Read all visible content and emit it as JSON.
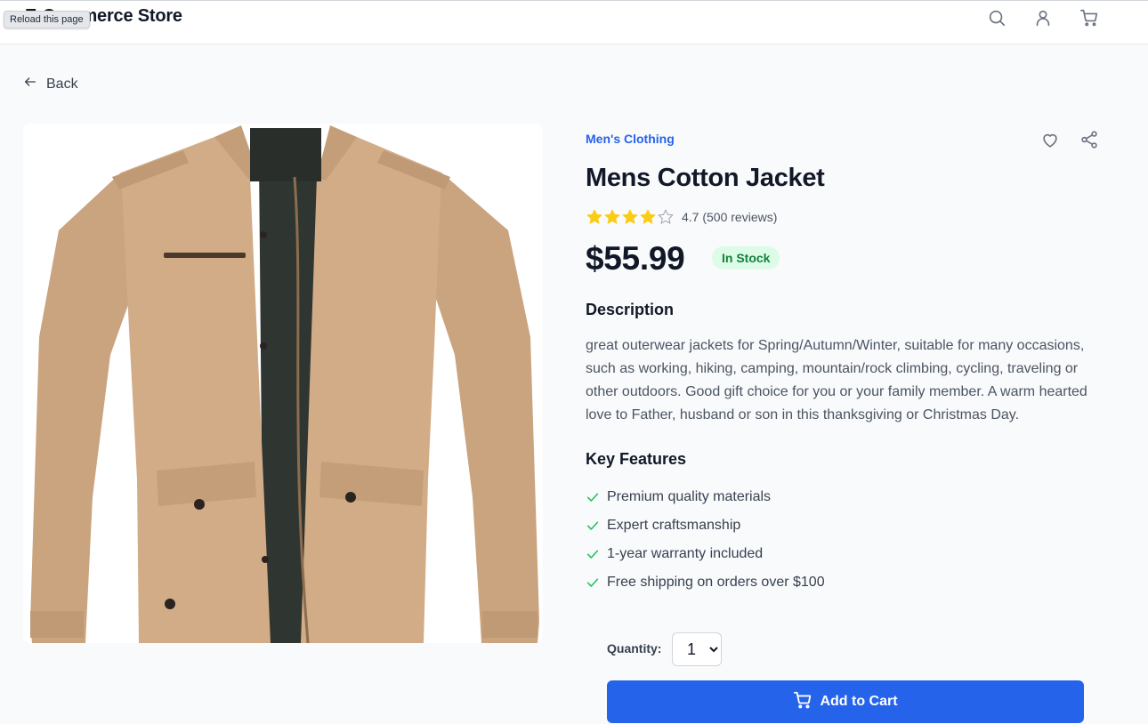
{
  "header": {
    "brand": "E-Commerce Store",
    "tooltip": "Reload this page",
    "icons": [
      "search-icon",
      "user-icon",
      "cart-icon"
    ]
  },
  "nav": {
    "back_label": "Back"
  },
  "product": {
    "category": "Men's Clothing",
    "title": "Mens Cotton Jacket",
    "rating": 4.7,
    "rating_text": "4.7 (500 reviews)",
    "stars_filled": 4,
    "stars_total": 5,
    "price": "$55.99",
    "stock_badge": "In Stock",
    "description_heading": "Description",
    "description": "great outerwear jackets for Spring/Autumn/Winter, suitable for many occasions, such as working, hiking, camping, mountain/rock climbing, cycling, traveling or other outdoors. Good gift choice for you or your family member. A warm hearted love to Father, husband or son in this thanksgiving or Christmas Day.",
    "features_heading": "Key Features",
    "features": [
      "Premium quality materials",
      "Expert craftsmanship",
      "1-year warranty included",
      "Free shipping on orders over $100"
    ],
    "image_alt": "Mens Cotton Jacket"
  },
  "purchase": {
    "quantity_label": "Quantity:",
    "quantity_value": "1",
    "quantity_options": [
      "1"
    ],
    "add_to_cart_label": "Add to Cart"
  },
  "colors": {
    "accent": "#2563eb",
    "star": "#facc15",
    "in_stock_bg": "#dcfce7",
    "in_stock_text": "#15803d",
    "check": "#22c55e"
  }
}
